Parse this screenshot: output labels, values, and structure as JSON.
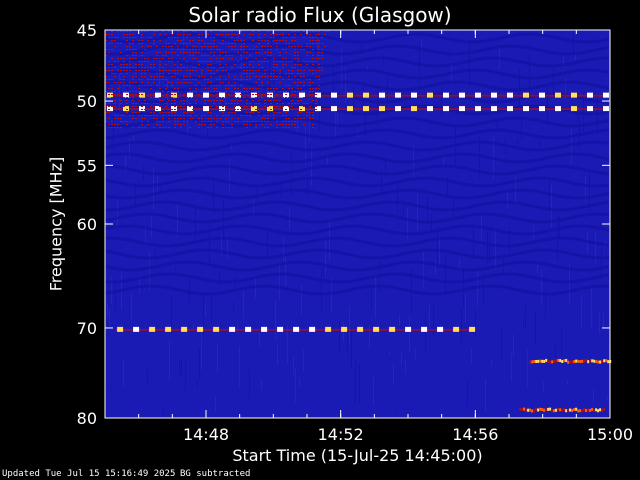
{
  "chart_data": {
    "type": "heatmap",
    "title": "Solar radio Flux (Glasgow)",
    "xlabel": "Start Time (15-Jul-25 14:45:00)",
    "ylabel": "Frequency [MHz]",
    "x_range_minutes_after_start": [
      0,
      15
    ],
    "x_ticks": [
      {
        "label": "14:48",
        "minutes": 3
      },
      {
        "label": "14:52",
        "minutes": 7
      },
      {
        "label": "14:56",
        "minutes": 11
      },
      {
        "label": "15:00",
        "minutes": 15
      }
    ],
    "y_scale": "log",
    "y_range": [
      45,
      80
    ],
    "y_inverted": true,
    "y_ticks": [
      {
        "label": "45",
        "value": 45
      },
      {
        "label": "50",
        "value": 50
      },
      {
        "label": "55",
        "value": 55
      },
      {
        "label": "60",
        "value": 60
      },
      {
        "label": "70",
        "value": 70
      },
      {
        "label": "80",
        "value": 80
      }
    ],
    "colormap": [
      "#000000",
      "#1010a0",
      "#2a2af0",
      "#b01010",
      "#ff6000",
      "#ffe060",
      "#ffffff"
    ],
    "background_color": "#1a1ab4",
    "features": [
      {
        "name": "interference band",
        "freq_mhz": 49.6,
        "start_min": 0,
        "end_min": 15
      },
      {
        "name": "interference band",
        "freq_mhz": 50.6,
        "start_min": 0,
        "end_min": 15
      },
      {
        "name": "interference band",
        "freq_mhz": 70.2,
        "start_min": 0.3,
        "end_min": 11
      },
      {
        "name": "burst",
        "freq_mhz": 73.5,
        "start_min": 12.6,
        "end_min": 15
      },
      {
        "name": "burst",
        "freq_mhz": 79,
        "start_min": 12.3,
        "end_min": 14.8
      },
      {
        "name": "enhanced emission",
        "freq_low_mhz": 45,
        "freq_high_mhz": 52,
        "start_min": 0,
        "end_min": 6.6
      }
    ]
  },
  "footer": {
    "updated": "Updated Tue Jul 15 15:16:49 2025",
    "note": "BG subtracted"
  }
}
